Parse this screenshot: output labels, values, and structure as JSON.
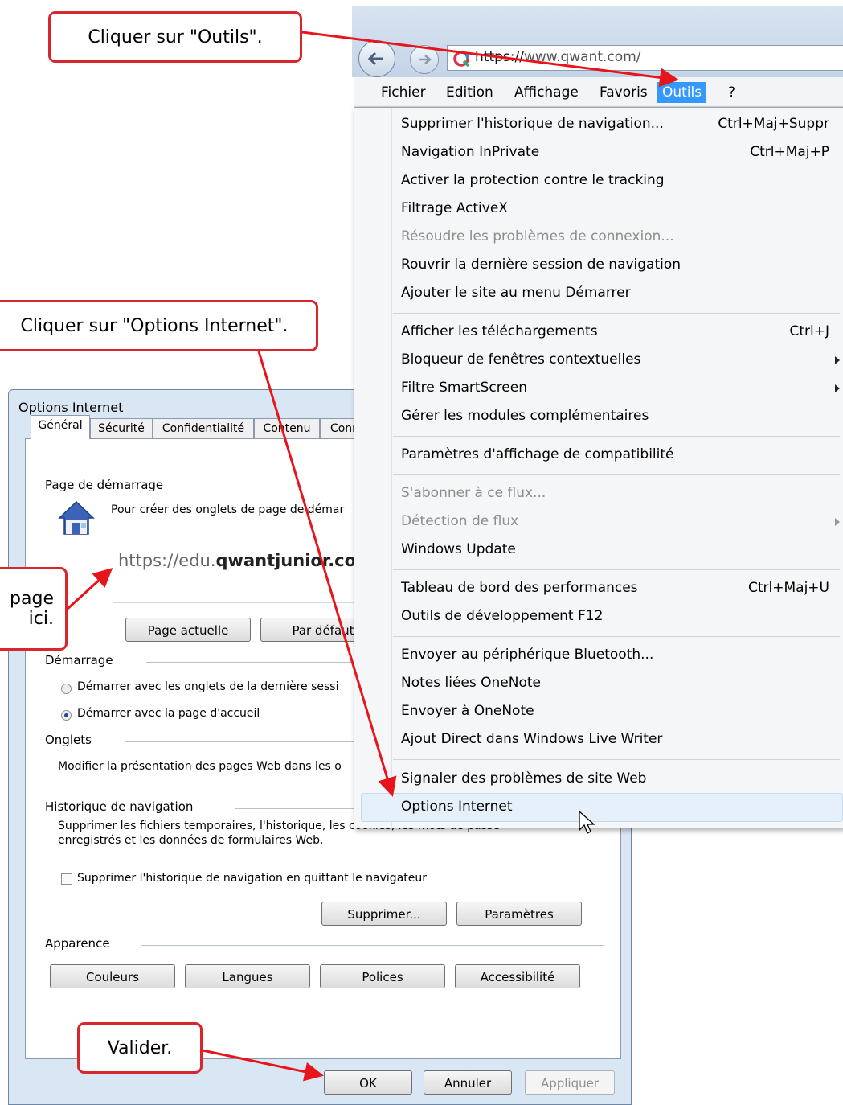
{
  "browser": {
    "address": "https://www.qwant.com/",
    "address_host": "https://",
    "address_rest": "www.qwant.com/"
  },
  "menubar": {
    "items": [
      "Fichier",
      "Edition",
      "Affichage",
      "Favoris",
      "Outils",
      "?"
    ],
    "active": "Outils"
  },
  "tools_menu": {
    "items": [
      {
        "label": "Supprimer l'historique de navigation...",
        "shortcut": "Ctrl+Maj+Suppr"
      },
      {
        "label": "Navigation InPrivate",
        "shortcut": "Ctrl+Maj+P"
      },
      {
        "label": "Activer la protection contre le tracking",
        "shortcut": ""
      },
      {
        "label": "Filtrage ActiveX",
        "shortcut": ""
      },
      {
        "label": "Résoudre les problèmes de connexion...",
        "shortcut": "",
        "disabled": true
      },
      {
        "label": "Rouvrir la dernière session de navigation",
        "shortcut": ""
      },
      {
        "label": "Ajouter le site au menu Démarrer",
        "shortcut": ""
      },
      {
        "label": "Afficher les téléchargements",
        "shortcut": "Ctrl+J"
      },
      {
        "label": "Bloqueur de fenêtres contextuelles",
        "shortcut": "",
        "submenu": true
      },
      {
        "label": "Filtre SmartScreen",
        "shortcut": "",
        "submenu": true
      },
      {
        "label": "Gérer les modules complémentaires",
        "shortcut": ""
      },
      {
        "label": "Paramètres d'affichage de compatibilité",
        "shortcut": ""
      },
      {
        "label": "S'abonner à ce flux...",
        "shortcut": "",
        "disabled": true
      },
      {
        "label": "Détection de flux",
        "shortcut": "",
        "disabled": true,
        "submenu": true
      },
      {
        "label": "Windows Update",
        "shortcut": ""
      },
      {
        "label": "Tableau de bord des performances",
        "shortcut": "Ctrl+Maj+U"
      },
      {
        "label": "Outils de développement F12",
        "shortcut": ""
      },
      {
        "label": "Envoyer au périphérique Bluetooth...",
        "shortcut": ""
      },
      {
        "label": "Notes liées OneNote",
        "shortcut": ""
      },
      {
        "label": "Envoyer à OneNote",
        "shortcut": ""
      },
      {
        "label": "Ajout Direct dans Windows Live Writer",
        "shortcut": ""
      },
      {
        "label": "Signaler des problèmes de site Web",
        "shortcut": ""
      },
      {
        "label": "Options Internet",
        "shortcut": "",
        "highlighted": true
      }
    ]
  },
  "dialog": {
    "title": "Options Internet",
    "tabs": [
      "Général",
      "Sécurité",
      "Confidentialité",
      "Contenu",
      "Conn"
    ],
    "home_group": "Page de démarrage",
    "home_text": "Pour créer des onglets de page de démar",
    "home_url_prefix": "https://edu.",
    "home_url_main": "qwantjunior.com",
    "btn_current": "Page actuelle",
    "btn_default": "Par défaut",
    "startup_group": "Démarrage",
    "radio_last": "Démarrer avec les onglets de la dernière sessi",
    "radio_home": "Démarrer avec la page d'accueil",
    "tabs_group": "Onglets",
    "tabs_text": "Modifier la présentation des pages Web dans les o",
    "history_group": "Historique de navigation",
    "history_text1": "Supprimer les fichiers temporaires, l'historique, les cookies, les mots de passe",
    "history_text2": "enregistrés et les données de formulaires Web.",
    "history_check": "Supprimer l'historique de navigation en quittant le navigateur",
    "btn_delete": "Supprimer...",
    "btn_settings": "Paramètres",
    "appearance_group": "Apparence",
    "btn_colors": "Couleurs",
    "btn_languages": "Langues",
    "btn_fonts": "Polices",
    "btn_accessibility": "Accessibilité",
    "btn_ok": "OK",
    "btn_cancel": "Annuler",
    "btn_apply": "Appliquer"
  },
  "callouts": {
    "outils": "Cliquer sur \"Outils\".",
    "options": "Cliquer sur \"Options Internet\".",
    "page_line1": "page",
    "page_line2": "ici.",
    "valider": "Valider."
  },
  "colors": {
    "callout_border": "#d9262c",
    "arrow": "#e8141c",
    "menu_active": "#3399ff"
  }
}
